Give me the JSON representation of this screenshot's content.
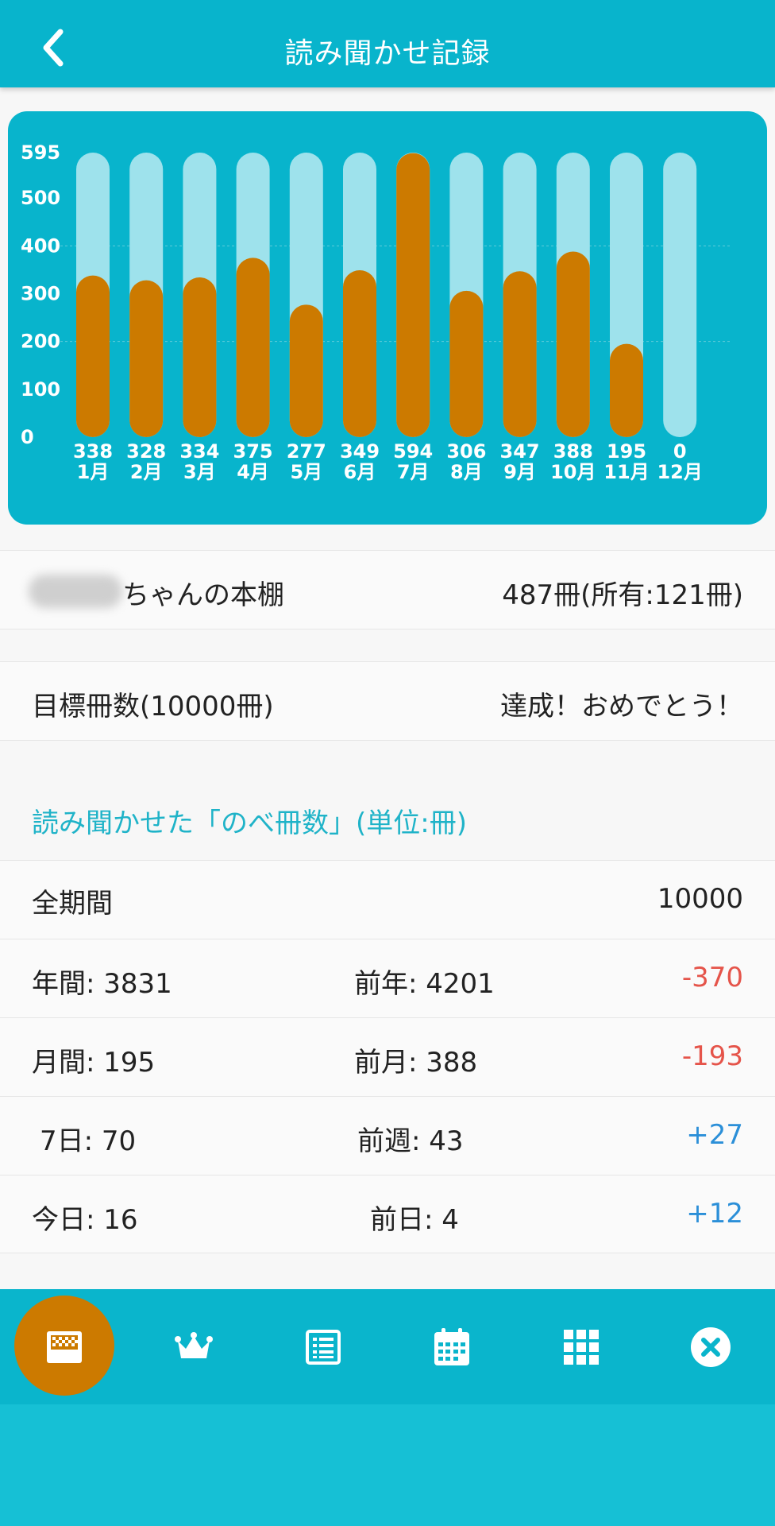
{
  "header": {
    "title": "読み聞かせ記録",
    "back_icon": "chevron-left-icon"
  },
  "colors": {
    "primary": "#08b4cc",
    "bar_track": "#9ee2ec",
    "bar_fill": "#cc7a00",
    "negative": "#e5544a",
    "positive": "#2b8fd8",
    "section_label": "#1fb3c8"
  },
  "chart_data": {
    "type": "bar",
    "categories": [
      "1月",
      "2月",
      "3月",
      "4月",
      "5月",
      "6月",
      "7月",
      "8月",
      "9月",
      "10月",
      "11月",
      "12月"
    ],
    "values": [
      338,
      328,
      334,
      375,
      277,
      349,
      594,
      306,
      347,
      388,
      195,
      0
    ],
    "value_labels": [
      "338",
      "328",
      "334",
      "375",
      "277",
      "349",
      "594",
      "306",
      "347",
      "388",
      "195",
      "0"
    ],
    "y_ticks": [
      "595",
      "500",
      "400",
      "300",
      "200",
      "100",
      "0"
    ],
    "ylim": [
      0,
      595
    ],
    "title": "",
    "xlabel": "",
    "ylabel": ""
  },
  "shelf": {
    "suffix": "ちゃんの本棚",
    "count": "487冊(所有:121冊)"
  },
  "goal": {
    "label": "目標冊数(10000冊)",
    "status": "達成！おめでとう！"
  },
  "section": {
    "label": "読み聞かせた「のべ冊数」(単位:冊)"
  },
  "stats": {
    "all": {
      "label": "全期間",
      "value": "10000"
    },
    "year": {
      "current": "年間: 3831",
      "previous": "前年: 4201",
      "diff": "-370"
    },
    "month": {
      "current": "月間: 195",
      "previous": "前月: 388",
      "diff": "-193"
    },
    "week": {
      "current": "7日: 70",
      "previous": "前週: 43",
      "diff": "+27"
    },
    "day": {
      "current": "今日: 16",
      "previous": "前日: 4",
      "diff": "+12"
    }
  },
  "nav": {
    "items": [
      {
        "icon": "chart-grid-icon",
        "active": true
      },
      {
        "icon": "crown-icon",
        "active": false
      },
      {
        "icon": "list-icon",
        "active": false
      },
      {
        "icon": "calendar-icon",
        "active": false
      },
      {
        "icon": "grid-icon",
        "active": false
      },
      {
        "icon": "close-circle-icon",
        "active": false
      }
    ]
  }
}
